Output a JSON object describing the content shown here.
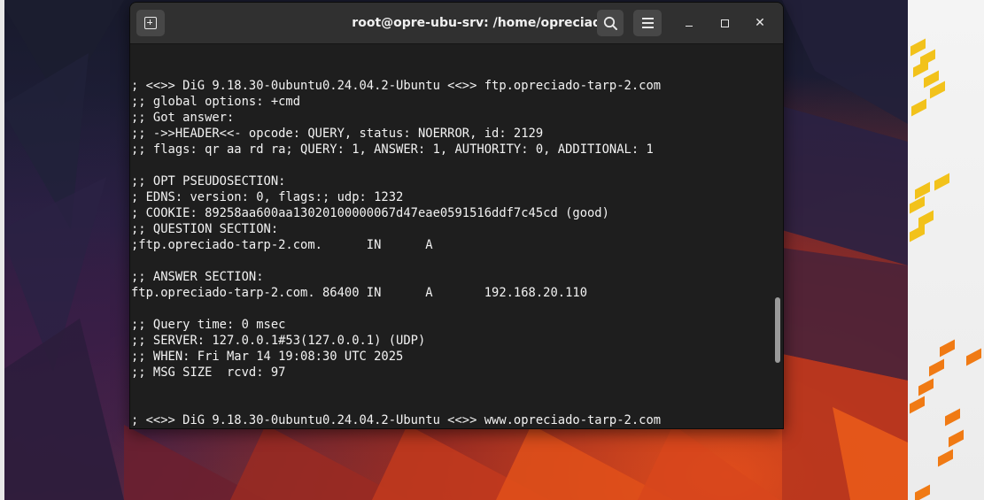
{
  "window": {
    "title": "root@opre-ubu-srv: /home/opreciado",
    "icons": {
      "new_tab": "new-tab-icon",
      "search": "search-icon",
      "menu": "hamburger-menu-icon",
      "minimize": "minimize-icon",
      "maximize": "maximize-icon",
      "close": "close-icon"
    },
    "close_glyph": "✕"
  },
  "terminal": {
    "lines": [
      "; <<>> DiG 9.18.30-0ubuntu0.24.04.2-Ubuntu <<>> ftp.opreciado-tarp-2.com",
      ";; global options: +cmd",
      ";; Got answer:",
      ";; ->>HEADER<<- opcode: QUERY, status: NOERROR, id: 2129",
      ";; flags: qr aa rd ra; QUERY: 1, ANSWER: 1, AUTHORITY: 0, ADDITIONAL: 1",
      "",
      ";; OPT PSEUDOSECTION:",
      "; EDNS: version: 0, flags:; udp: 1232",
      "; COOKIE: 89258aa600aa13020100000067d47eae0591516ddf7c45cd (good)",
      ";; QUESTION SECTION:",
      ";ftp.opreciado-tarp-2.com.      IN      A",
      "",
      ";; ANSWER SECTION:",
      "ftp.opreciado-tarp-2.com. 86400 IN      A       192.168.20.110",
      "",
      ";; Query time: 0 msec",
      ";; SERVER: 127.0.0.1#53(127.0.0.1) (UDP)",
      ";; WHEN: Fri Mar 14 19:08:30 UTC 2025",
      ";; MSG SIZE  rcvd: 97",
      "",
      "",
      "; <<>> DiG 9.18.30-0ubuntu0.24.04.2-Ubuntu <<>> www.opreciado-tarp-2.com"
    ]
  },
  "colors": {
    "terminal_bg": "#1e1e1e",
    "terminal_fg": "#f2f2f2",
    "titlebar_bg": "#303030",
    "accent_yellow": "#f2c21b",
    "accent_orange": "#f07a14"
  }
}
